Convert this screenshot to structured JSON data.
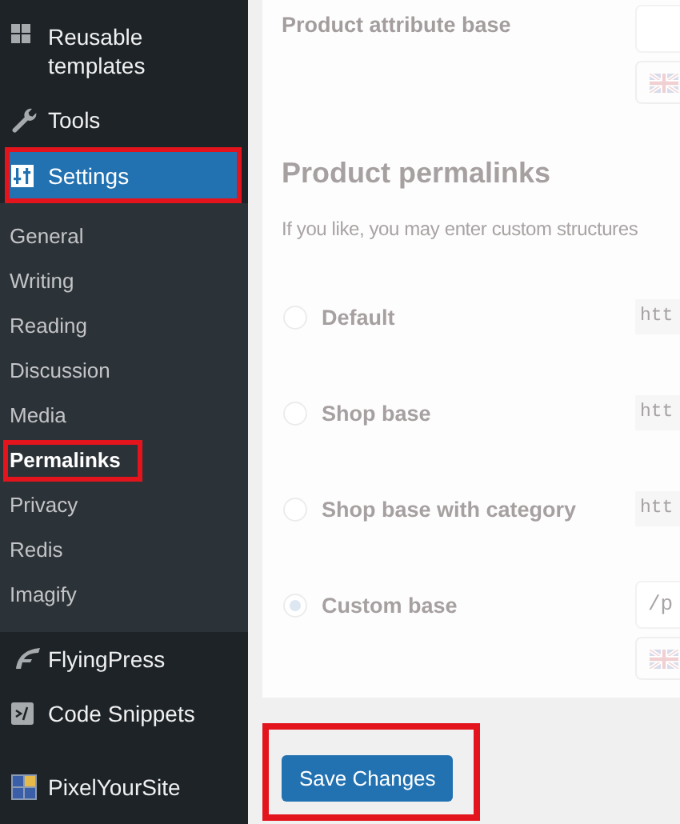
{
  "sidebar": {
    "items": [
      {
        "label": "Reusable templates",
        "selected": false,
        "highlighted": false
      },
      {
        "label": "Tools",
        "selected": false,
        "highlighted": false
      },
      {
        "label": "Settings",
        "selected": true,
        "highlighted": true,
        "children": [
          {
            "label": "General",
            "selected": false,
            "highlighted": false
          },
          {
            "label": "Writing",
            "selected": false,
            "highlighted": false
          },
          {
            "label": "Reading",
            "selected": false,
            "highlighted": false
          },
          {
            "label": "Discussion",
            "selected": false,
            "highlighted": false
          },
          {
            "label": "Media",
            "selected": false,
            "highlighted": false
          },
          {
            "label": "Permalinks",
            "selected": true,
            "highlighted": true
          },
          {
            "label": "Privacy",
            "selected": false,
            "highlighted": false
          },
          {
            "label": "Redis",
            "selected": false,
            "highlighted": false
          },
          {
            "label": "Imagify",
            "selected": false,
            "highlighted": false
          }
        ]
      },
      {
        "label": "FlyingPress",
        "selected": false,
        "highlighted": false
      },
      {
        "label": "Code Snippets",
        "selected": false,
        "highlighted": false
      },
      {
        "label": "PixelYourSite",
        "selected": false,
        "highlighted": false
      }
    ]
  },
  "panel": {
    "attribute_base": {
      "label": "Product attribute base"
    },
    "heading": "Product permalinks",
    "description": "If you like, you may enter custom structures",
    "options": [
      {
        "label": "Default",
        "selected": false,
        "kind": "code",
        "value": "htt"
      },
      {
        "label": "Shop base",
        "selected": false,
        "kind": "code",
        "value": "htt"
      },
      {
        "label": "Shop base with category",
        "selected": false,
        "kind": "code",
        "value": "htt"
      },
      {
        "label": "Custom base",
        "selected": true,
        "kind": "input",
        "value": "/p"
      }
    ]
  },
  "save_button": {
    "label": "Save Changes",
    "highlighted": true
  }
}
